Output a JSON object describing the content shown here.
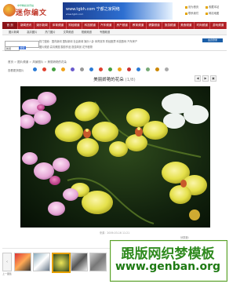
{
  "header": {
    "site_name": "迷你编文",
    "slogan": "中华精彩资讯站",
    "banner_text": "www.tgbh.com 宁都之家网络",
    "banner_sub": "www.tgbh.com",
    "top_links": [
      "设为首页",
      "收藏本站",
      "联系我们",
      "网站地图"
    ]
  },
  "nav": {
    "items": [
      "首 页",
      "新闻资讯",
      "娱乐新闻",
      "体育频道",
      "财经频道",
      "科技频道",
      "汽车频道",
      "房产频道",
      "教育频道",
      "健康频道",
      "旅游频道",
      "美食频道",
      "时尚频道",
      "游戏频道"
    ],
    "sub_items": [
      "图片新闻",
      "高清图片",
      "热门图片",
      "文章频道",
      "视频频道",
      "专题频道"
    ]
  },
  "search": {
    "placeholder": "",
    "select_value": "新闻",
    "button": "搜索",
    "hot_words": "热门搜索：国内新闻 国际新闻 社会新闻 娱乐八卦 体育赛事 财经股票 科技数码 汽车房产",
    "hot_words2": "图片频道 高清美图 摄影作品 旅游风景 花卉植物",
    "login": "会员登录"
  },
  "breadcrumb": [
    "首页",
    "图片频道",
    "风景图片",
    "美丽娇艳的花朵"
  ],
  "toolbar": {
    "label": "查看更多图片"
  },
  "photo": {
    "title": "美丽娇艳的花朵",
    "counter": "(1/8)",
    "caption": "来源：2009-03-16 11:21",
    "share": "分享到："
  },
  "controls": [
    "◀",
    "▶",
    "▣"
  ],
  "filmstrip": {
    "prev": "‹",
    "label": "上一图集"
  },
  "watermark": {
    "line1": "跟版网织梦模板",
    "line2": "www.genban.org"
  },
  "colors": {
    "nav_bg": "#b01f24",
    "accent": "#e5a000",
    "watermark_green": "#2f8a1e"
  }
}
